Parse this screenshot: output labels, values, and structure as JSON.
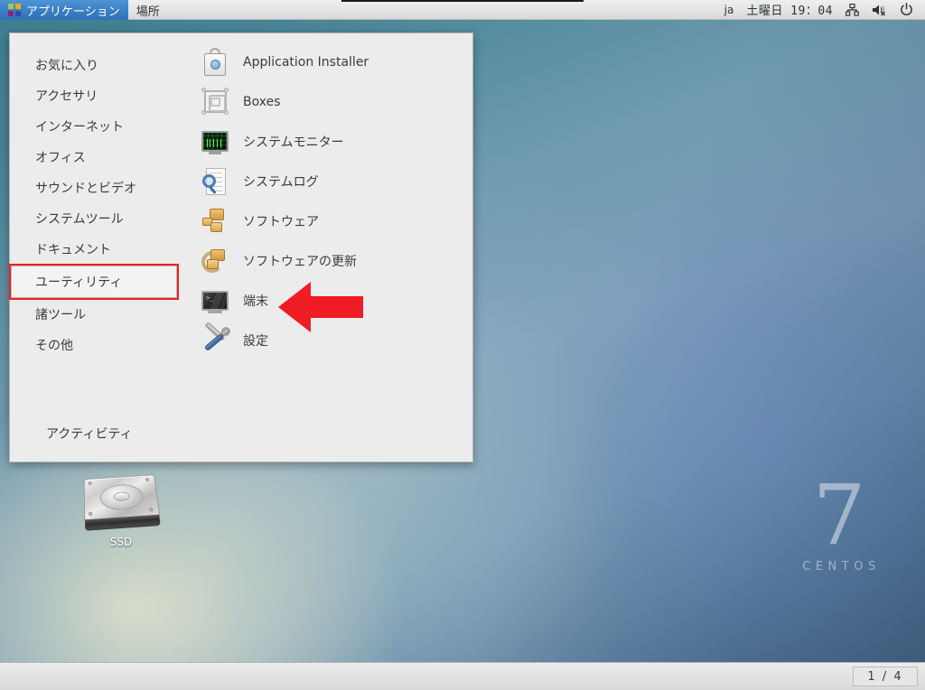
{
  "top_panel": {
    "applications_menu_label": "アプリケーション",
    "places_menu_label": "場所",
    "logo_icon": "centos-logo-icon",
    "language_indicator": "ja",
    "clock": "土曜日 19：04",
    "network_icon": "network-icon",
    "volume_icon": "volume-muted-icon",
    "power_icon": "power-icon"
  },
  "applications_menu": {
    "categories": [
      {
        "label": "お気に入り",
        "highlighted": false
      },
      {
        "label": "アクセサリ",
        "highlighted": false
      },
      {
        "label": "インターネット",
        "highlighted": false
      },
      {
        "label": "オフィス",
        "highlighted": false
      },
      {
        "label": "サウンドとビデオ",
        "highlighted": false
      },
      {
        "label": "システムツール",
        "highlighted": false
      },
      {
        "label": "ドキュメント",
        "highlighted": false
      },
      {
        "label": "ユーティリティ",
        "highlighted": true
      },
      {
        "label": "諸ツール",
        "highlighted": false
      },
      {
        "label": "その他",
        "highlighted": false
      }
    ],
    "apps": [
      {
        "label": "Application Installer",
        "icon": "app-installer-icon"
      },
      {
        "label": "Boxes",
        "icon": "boxes-icon"
      },
      {
        "label": "システムモニター",
        "icon": "system-monitor-icon"
      },
      {
        "label": "システムログ",
        "icon": "system-log-icon"
      },
      {
        "label": "ソフトウェア",
        "icon": "software-icon"
      },
      {
        "label": "ソフトウェアの更新",
        "icon": "software-update-icon"
      },
      {
        "label": "端末",
        "icon": "terminal-icon"
      },
      {
        "label": "設定",
        "icon": "settings-icon"
      }
    ],
    "footer_label": "アクティビティ"
  },
  "desktop": {
    "ssd_icon_label": "SSD",
    "watermark_number": "7",
    "watermark_brand": "CENTOS"
  },
  "bottom_panel": {
    "workspace_indicator": "1 / 4"
  },
  "annotation": {
    "arrow_color": "#ef1c24",
    "highlight_color": "#f02020",
    "arrow_points_to": "端末"
  },
  "colors": {
    "panel_bg": "#e4e4e4",
    "menu_bg": "#ececec",
    "menu_accent": "#3a7fc4",
    "text": "#3b3b3b"
  }
}
